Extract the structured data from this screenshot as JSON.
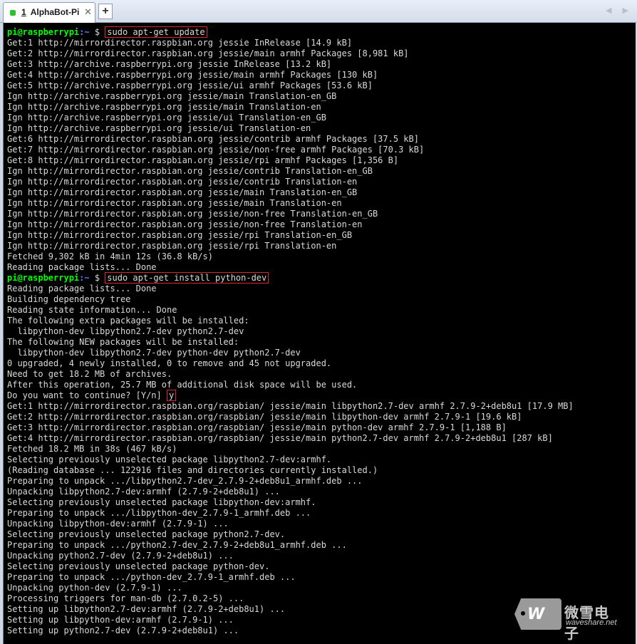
{
  "tab": {
    "number": "1",
    "title": "AlphaBot-Pi",
    "close": "✕",
    "new_tab": "+"
  },
  "nav": {
    "arrows": "◀ ▶"
  },
  "terminal": {
    "lines": [
      {
        "user": "pi@raspberrypi",
        "path": ":~",
        "sym": " $ ",
        "cmd": "sudo apt-get update"
      },
      "Get:1 http://mirrordirector.raspbian.org jessie InRelease [14.9 kB]",
      "Get:2 http://mirrordirector.raspbian.org jessie/main armhf Packages [8,981 kB]",
      "Get:3 http://archive.raspberrypi.org jessie InRelease [13.2 kB]",
      "Get:4 http://archive.raspberrypi.org jessie/main armhf Packages [130 kB]",
      "Get:5 http://archive.raspberrypi.org jessie/ui armhf Packages [53.6 kB]",
      "Ign http://archive.raspberrypi.org jessie/main Translation-en_GB",
      "Ign http://archive.raspberrypi.org jessie/main Translation-en",
      "Ign http://archive.raspberrypi.org jessie/ui Translation-en_GB",
      "Ign http://archive.raspberrypi.org jessie/ui Translation-en",
      "Get:6 http://mirrordirector.raspbian.org jessie/contrib armhf Packages [37.5 kB]",
      "Get:7 http://mirrordirector.raspbian.org jessie/non-free armhf Packages [70.3 kB]",
      "Get:8 http://mirrordirector.raspbian.org jessie/rpi armhf Packages [1,356 B]",
      "Ign http://mirrordirector.raspbian.org jessie/contrib Translation-en_GB",
      "Ign http://mirrordirector.raspbian.org jessie/contrib Translation-en",
      "Ign http://mirrordirector.raspbian.org jessie/main Translation-en_GB",
      "Ign http://mirrordirector.raspbian.org jessie/main Translation-en",
      "Ign http://mirrordirector.raspbian.org jessie/non-free Translation-en_GB",
      "Ign http://mirrordirector.raspbian.org jessie/non-free Translation-en",
      "Ign http://mirrordirector.raspbian.org jessie/rpi Translation-en_GB",
      "Ign http://mirrordirector.raspbian.org jessie/rpi Translation-en",
      "Fetched 9,302 kB in 4min 12s (36.8 kB/s)",
      "Reading package lists... Done",
      {
        "user": "pi@raspberrypi",
        "path": ":~",
        "sym": " $ ",
        "cmd": "sudo apt-get install python-dev"
      },
      "Reading package lists... Done",
      "Building dependency tree",
      "Reading state information... Done",
      "The following extra packages will be installed:",
      "  libpython-dev libpython2.7-dev python2.7-dev",
      "The following NEW packages will be installed:",
      "  libpython-dev libpython2.7-dev python-dev python2.7-dev",
      "0 upgraded, 4 newly installed, 0 to remove and 45 not upgraded.",
      "Need to get 18.2 MB of archives.",
      "After this operation, 25.7 MB of additional disk space will be used.",
      {
        "text": "Do you want to continue? [Y/n] ",
        "answer": "y"
      },
      "Get:1 http://mirrordirector.raspbian.org/raspbian/ jessie/main libpython2.7-dev armhf 2.7.9-2+deb8u1 [17.9 MB]",
      "Get:2 http://mirrordirector.raspbian.org/raspbian/ jessie/main libpython-dev armhf 2.7.9-1 [19.6 kB]",
      "Get:3 http://mirrordirector.raspbian.org/raspbian/ jessie/main python-dev armhf 2.7.9-1 [1,188 B]",
      "Get:4 http://mirrordirector.raspbian.org/raspbian/ jessie/main python2.7-dev armhf 2.7.9-2+deb8u1 [287 kB]",
      "Fetched 18.2 MB in 38s (467 kB/s)",
      "Selecting previously unselected package libpython2.7-dev:armhf.",
      "(Reading database ... 122916 files and directories currently installed.)",
      "Preparing to unpack .../libpython2.7-dev_2.7.9-2+deb8u1_armhf.deb ...",
      "Unpacking libpython2.7-dev:armhf (2.7.9-2+deb8u1) ...",
      "Selecting previously unselected package libpython-dev:armhf.",
      "Preparing to unpack .../libpython-dev_2.7.9-1_armhf.deb ...",
      "Unpacking libpython-dev:armhf (2.7.9-1) ...",
      "Selecting previously unselected package python2.7-dev.",
      "Preparing to unpack .../python2.7-dev_2.7.9-2+deb8u1_armhf.deb ...",
      "Unpacking python2.7-dev (2.7.9-2+deb8u1) ...",
      "Selecting previously unselected package python-dev.",
      "Preparing to unpack .../python-dev_2.7.9-1_armhf.deb ...",
      "Unpacking python-dev (2.7.9-1) ...",
      "Processing triggers for man-db (2.7.0.2-5) ...",
      "Setting up libpython2.7-dev:armhf (2.7.9-2+deb8u1) ...",
      "Setting up libpython-dev:armhf (2.7.9-1) ...",
      "Setting up python2.7-dev (2.7.9-2+deb8u1) ..."
    ]
  },
  "watermark": {
    "logo": "W",
    "cn": "微雪电子",
    "url": "waveshare.net"
  },
  "colors": {
    "prompt_user": "#00ff00",
    "prompt_path": "#5f7fff",
    "highlight": "#e0232e",
    "text": "#d9d9d9",
    "background": "#000000"
  }
}
